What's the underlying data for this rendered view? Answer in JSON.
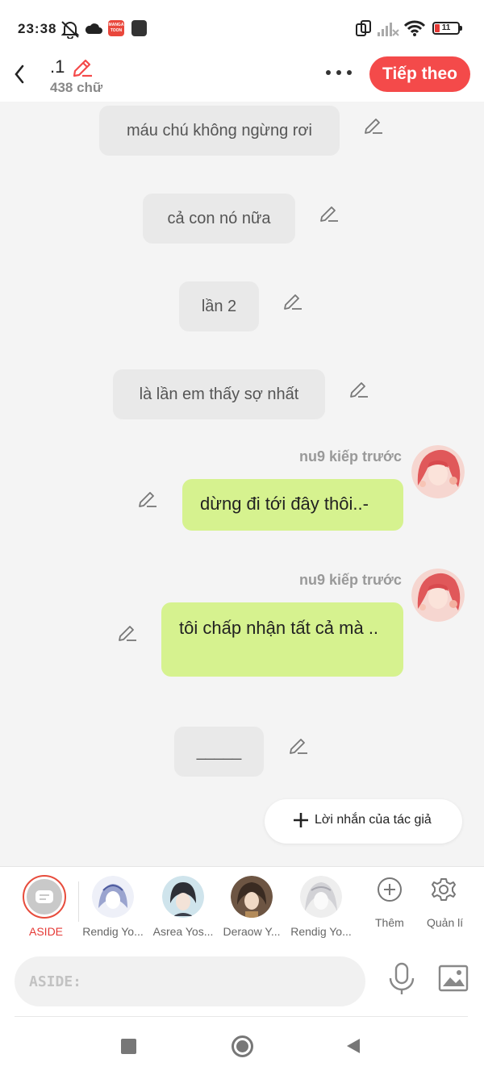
{
  "status": {
    "time": "23:38",
    "battery": "11",
    "app_badge": "MANGA TOON"
  },
  "header": {
    "title": ".1",
    "word_count": "438 chữ",
    "next_label": "Tiếp theo"
  },
  "messages": [
    {
      "type": "narration",
      "text": "máu chú không ngừng rơi"
    },
    {
      "type": "narration",
      "text": "cả con nó nữa"
    },
    {
      "type": "narration",
      "text": "lần 2"
    },
    {
      "type": "narration",
      "text": "là lần em thấy sợ nhất"
    },
    {
      "type": "character",
      "sender": "nu9 kiếp trước",
      "text": "dừng đi tới đây thôi..-"
    },
    {
      "type": "character",
      "sender": "nu9 kiếp trước",
      "text": "tôi chấp nhận tất cả mà .."
    },
    {
      "type": "narration",
      "text": "_____"
    }
  ],
  "author_note_label": "Lời nhắn của tác giả",
  "characters": {
    "aside_label": "ASIDE",
    "list": [
      {
        "name": "Rendig Yo..."
      },
      {
        "name": "Asrea Yos..."
      },
      {
        "name": "Deraow Y..."
      },
      {
        "name": "Rendig Yo..."
      }
    ],
    "add_label": "Thêm",
    "manage_label": "Quản lí"
  },
  "input": {
    "placeholder": "ASIDE:"
  },
  "colors": {
    "accent": "#f44a4a",
    "bubble_green": "#d6f28f",
    "bubble_gray": "#e9e9e9"
  }
}
